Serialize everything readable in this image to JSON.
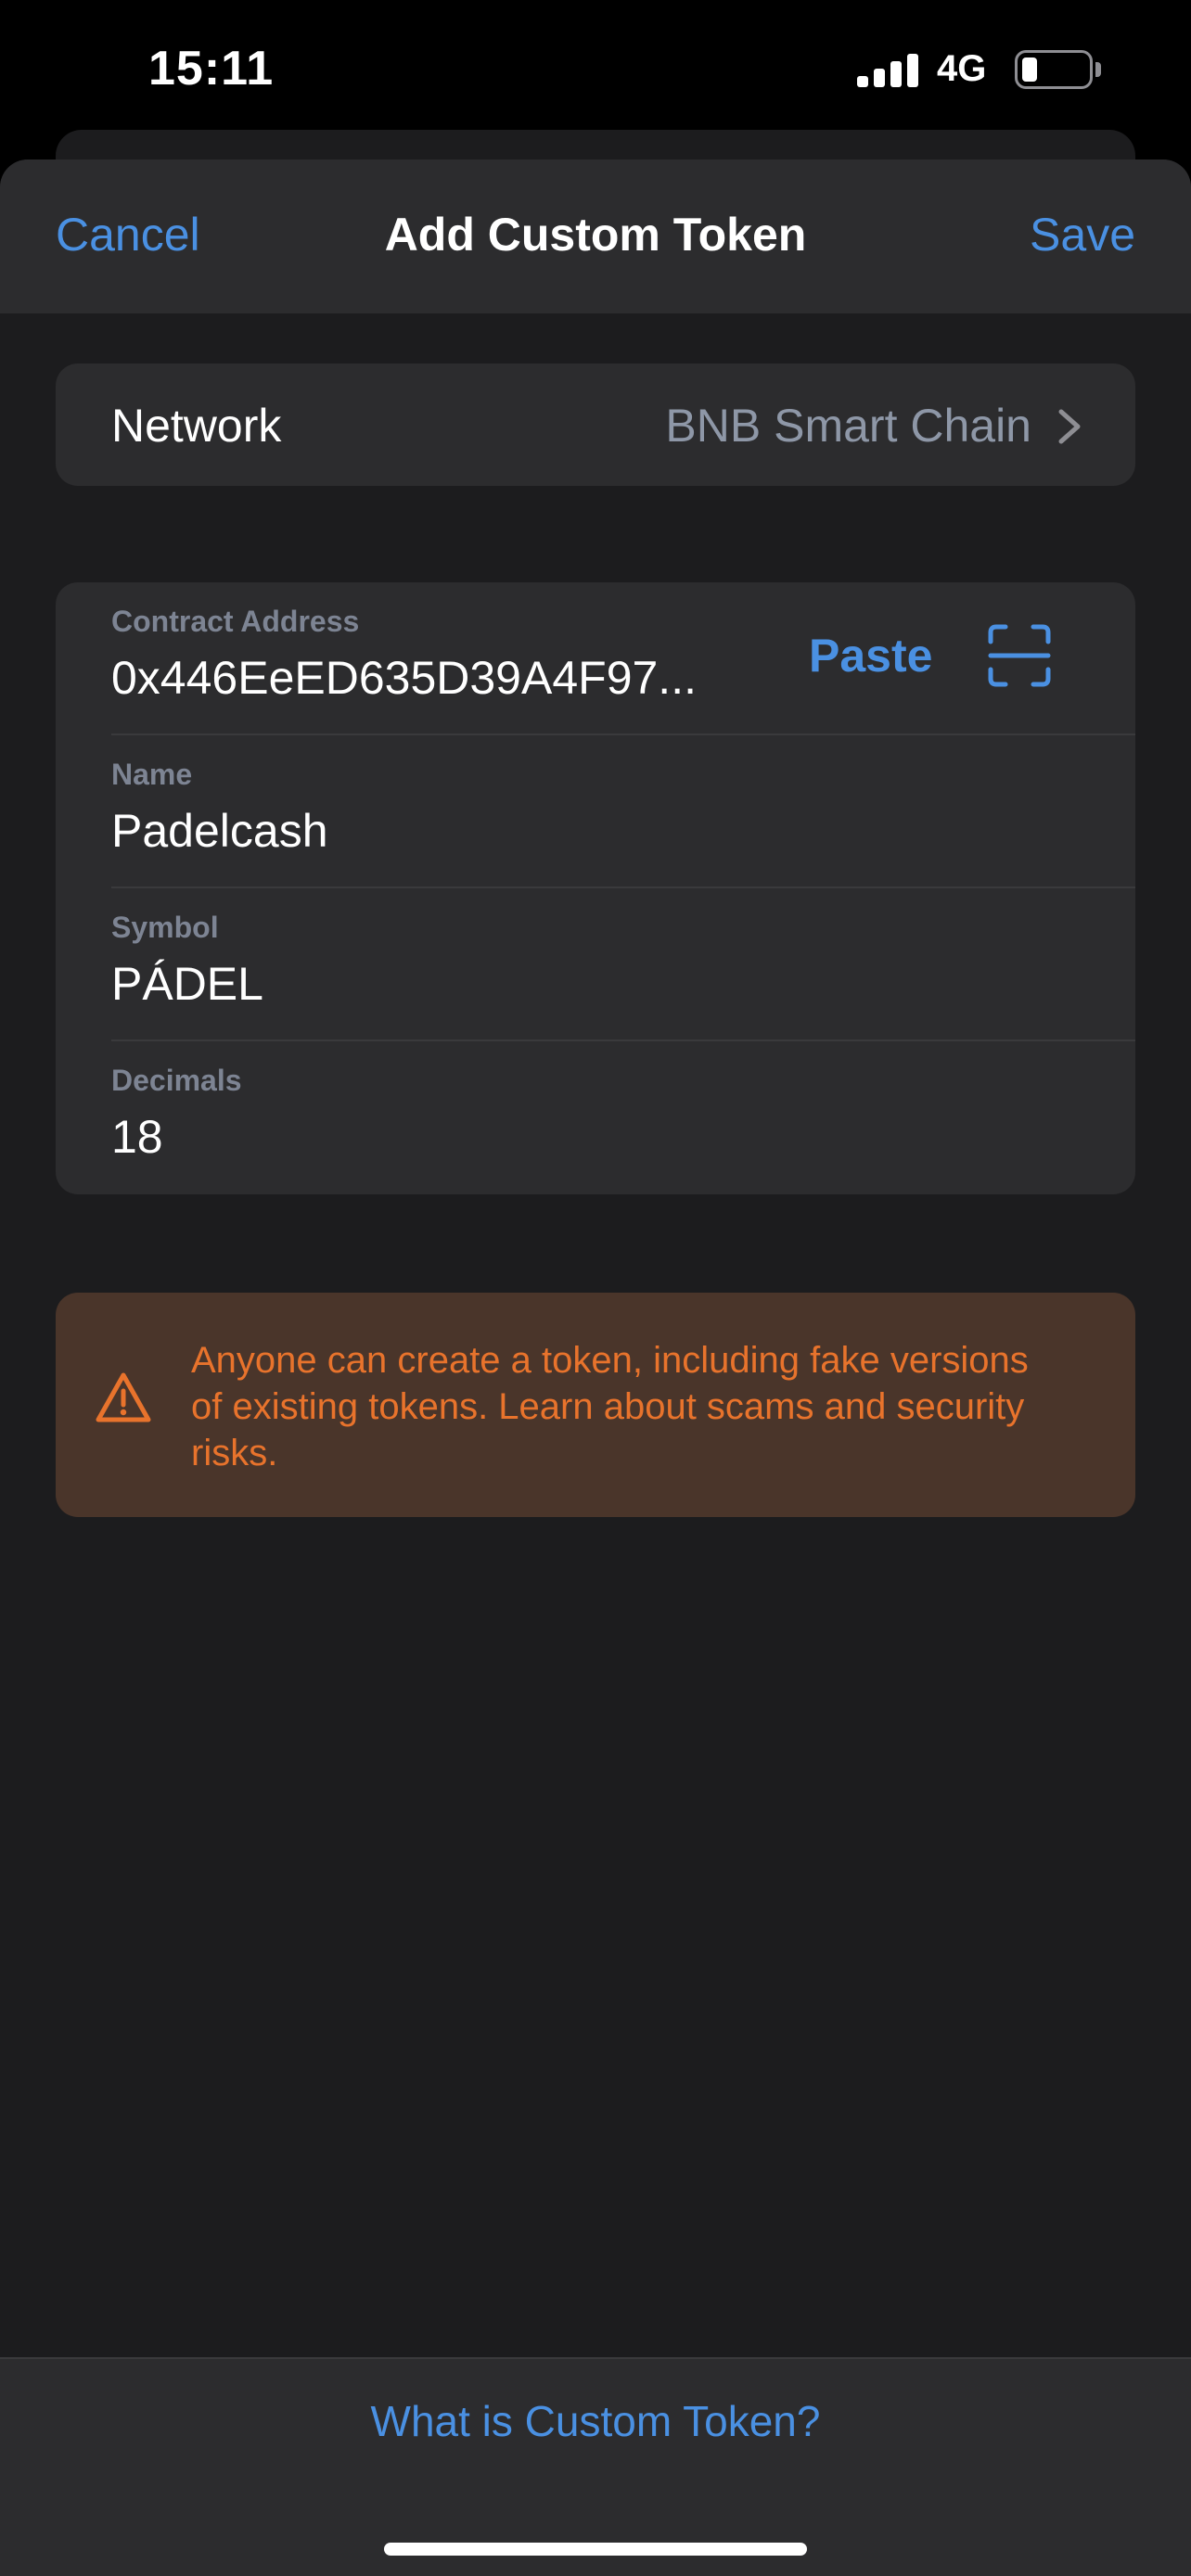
{
  "status_bar": {
    "time": "15:11",
    "network": "4G"
  },
  "nav": {
    "cancel": "Cancel",
    "title": "Add Custom Token",
    "save": "Save"
  },
  "network_row": {
    "label": "Network",
    "value": "BNB Smart Chain"
  },
  "fields": {
    "contract": {
      "label": "Contract Address",
      "value": "0x446EeED635D39A4F97...",
      "paste": "Paste"
    },
    "name": {
      "label": "Name",
      "value": "Padelcash"
    },
    "symbol": {
      "label": "Symbol",
      "value": "PÁDEL"
    },
    "decimals": {
      "label": "Decimals",
      "value": "18"
    }
  },
  "warning": {
    "text": "Anyone can create a token, including fake versions of existing tokens. Learn about scams and security risks."
  },
  "footer": {
    "link": "What is Custom Token?"
  },
  "colors": {
    "accent": "#4a90e2",
    "warning": "#e8732c",
    "warning_bg": "#4a352a",
    "card": "#2c2c2e",
    "background": "#1c1c1e"
  },
  "icons": [
    "signal-icon",
    "battery-icon",
    "chevron-right-icon",
    "scan-icon",
    "warning-icon"
  ]
}
